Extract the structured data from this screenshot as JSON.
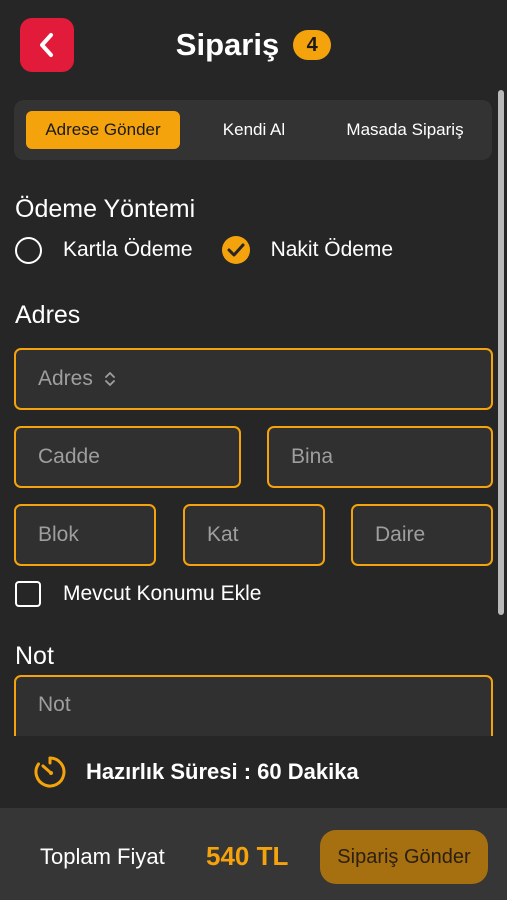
{
  "header": {
    "title": "Sipariş",
    "count_badge": "4"
  },
  "tabs": [
    {
      "label": "Adrese Gönder",
      "active": true
    },
    {
      "label": "Kendi Al",
      "active": false
    },
    {
      "label": "Masada Sipariş",
      "active": false
    }
  ],
  "payment": {
    "title": "Ödeme Yöntemi",
    "options": [
      {
        "label": "Kartla Ödeme",
        "selected": false
      },
      {
        "label": "Nakit Ödeme",
        "selected": true
      }
    ]
  },
  "address": {
    "title": "Adres",
    "select_placeholder": "Adres",
    "street_placeholder": "Cadde",
    "building_placeholder": "Bina",
    "block_placeholder": "Blok",
    "floor_placeholder": "Kat",
    "apartment_placeholder": "Daire",
    "use_location_label": "Mevcut Konumu Ekle"
  },
  "note": {
    "title": "Not",
    "placeholder": "Not"
  },
  "prep_time": {
    "label": "Hazırlık Süresi : 60 Dakika"
  },
  "footer": {
    "total_label": "Toplam Fiyat",
    "total_value": "540 TL",
    "submit_label": "Sipariş Gönder"
  },
  "colors": {
    "accent": "#f5a30c",
    "back_button": "#e31b3a",
    "background": "#262626"
  }
}
